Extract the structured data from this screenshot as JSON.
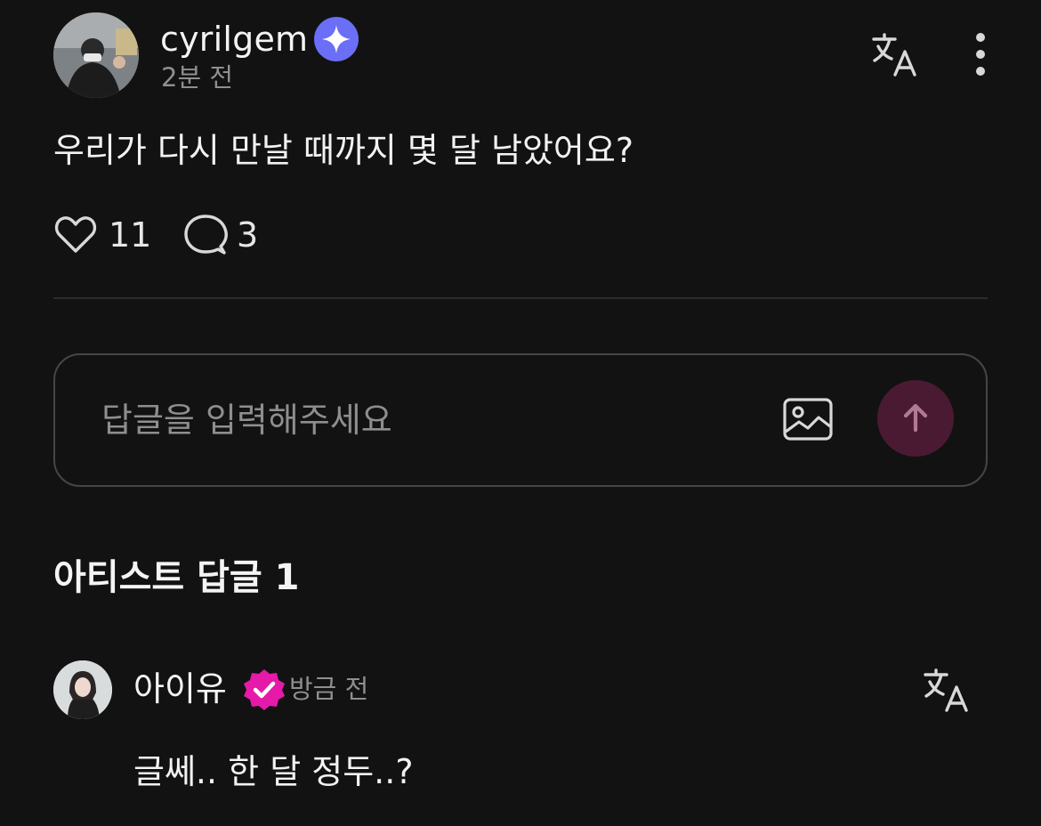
{
  "post": {
    "username": "cyrilgem",
    "time": "2분 전",
    "text": "우리가 다시 만날 때까지 몇 달 남았어요?",
    "likes_count": "11",
    "comments_count": "3"
  },
  "reply_input": {
    "placeholder": "답글을 입력해주세요",
    "value": ""
  },
  "artist_replies": {
    "section_title": "아티스트 답글 1",
    "items": [
      {
        "name": "아이유",
        "time": "방금 전",
        "text": "글쎄.. 한 달 정두..?"
      }
    ]
  },
  "icons": {
    "verified_user": "sparkle-badge-icon",
    "verified_artist": "check-badge-icon",
    "translate": "translate-icon",
    "more": "more-vertical-icon",
    "like": "heart-icon",
    "comment": "speech-bubble-icon",
    "attach_image": "image-icon",
    "send": "arrow-up-icon"
  },
  "colors": {
    "background": "#121212",
    "verified_blue": "#6b6ef7",
    "verified_pink": "#e61aa8",
    "send_button": "#4a1a33",
    "secondary_text": "#8f8f8f"
  }
}
